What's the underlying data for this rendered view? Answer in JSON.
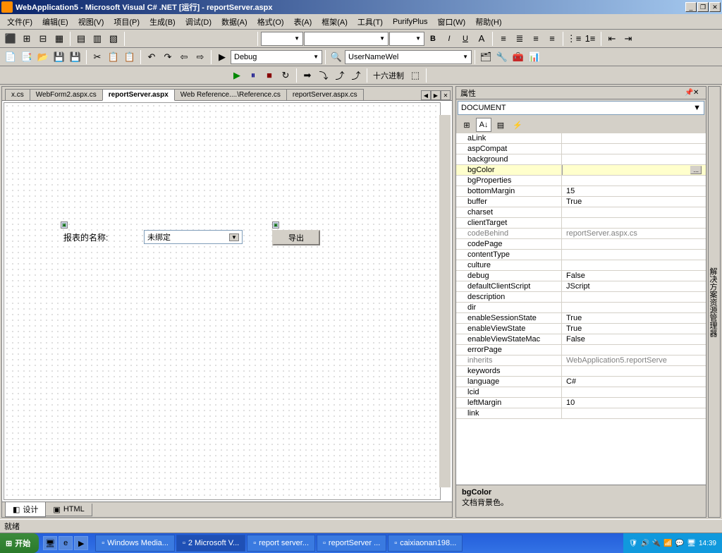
{
  "title": "WebApplication5 - Microsoft Visual C# .NET [运行] - reportServer.aspx",
  "menu": [
    "文件(F)",
    "编辑(E)",
    "视图(V)",
    "项目(P)",
    "生成(B)",
    "调试(D)",
    "数据(A)",
    "格式(O)",
    "表(A)",
    "框架(A)",
    "工具(T)",
    "PurifyPlus",
    "窗口(W)",
    "帮助(H)"
  ],
  "toolbar3": {
    "config": "Debug",
    "find": "UserNameWel"
  },
  "toolbar4": {
    "hex": "十六进制"
  },
  "tabs": [
    "x.cs",
    "WebForm2.aspx.cs",
    "reportServer.aspx",
    "Web Reference....\\Reference.cs",
    "reportServer.aspx.cs"
  ],
  "tabs_active": 2,
  "design": {
    "label": "报表的名称:",
    "select": "未绑定",
    "button": "导出"
  },
  "bottom_tabs": {
    "design": "设计",
    "html": "HTML"
  },
  "props": {
    "title": "属性",
    "object": "DOCUMENT",
    "rows": [
      {
        "n": "aLink",
        "v": ""
      },
      {
        "n": "aspCompat",
        "v": ""
      },
      {
        "n": "background",
        "v": ""
      },
      {
        "n": "bgColor",
        "v": "",
        "sel": true,
        "btn": true
      },
      {
        "n": "bgProperties",
        "v": ""
      },
      {
        "n": "bottomMargin",
        "v": "15"
      },
      {
        "n": "buffer",
        "v": "True"
      },
      {
        "n": "charset",
        "v": ""
      },
      {
        "n": "clientTarget",
        "v": ""
      },
      {
        "n": "codeBehind",
        "v": "reportServer.aspx.cs",
        "dis": true
      },
      {
        "n": "codePage",
        "v": ""
      },
      {
        "n": "contentType",
        "v": ""
      },
      {
        "n": "culture",
        "v": ""
      },
      {
        "n": "debug",
        "v": "False"
      },
      {
        "n": "defaultClientScript",
        "v": "JScript"
      },
      {
        "n": "description",
        "v": ""
      },
      {
        "n": "dir",
        "v": ""
      },
      {
        "n": "enableSessionState",
        "v": "True"
      },
      {
        "n": "enableViewState",
        "v": "True"
      },
      {
        "n": "enableViewStateMac",
        "v": "False"
      },
      {
        "n": "errorPage",
        "v": ""
      },
      {
        "n": "inherits",
        "v": "WebApplication5.reportServe",
        "dis": true
      },
      {
        "n": "keywords",
        "v": ""
      },
      {
        "n": "language",
        "v": "C#"
      },
      {
        "n": "lcid",
        "v": ""
      },
      {
        "n": "leftMargin",
        "v": "10"
      },
      {
        "n": "link",
        "v": ""
      }
    ],
    "desc_name": "bgColor",
    "desc_text": "文档背景色。"
  },
  "side_panel": "解决方案资源管理器",
  "status": "就绪",
  "taskbar": {
    "start": "开始",
    "tasks": [
      "Windows Media...",
      "2 Microsoft V...",
      "report server...",
      "reportServer ...",
      "caixiaonan198..."
    ],
    "active": 1,
    "time": "14:39"
  }
}
